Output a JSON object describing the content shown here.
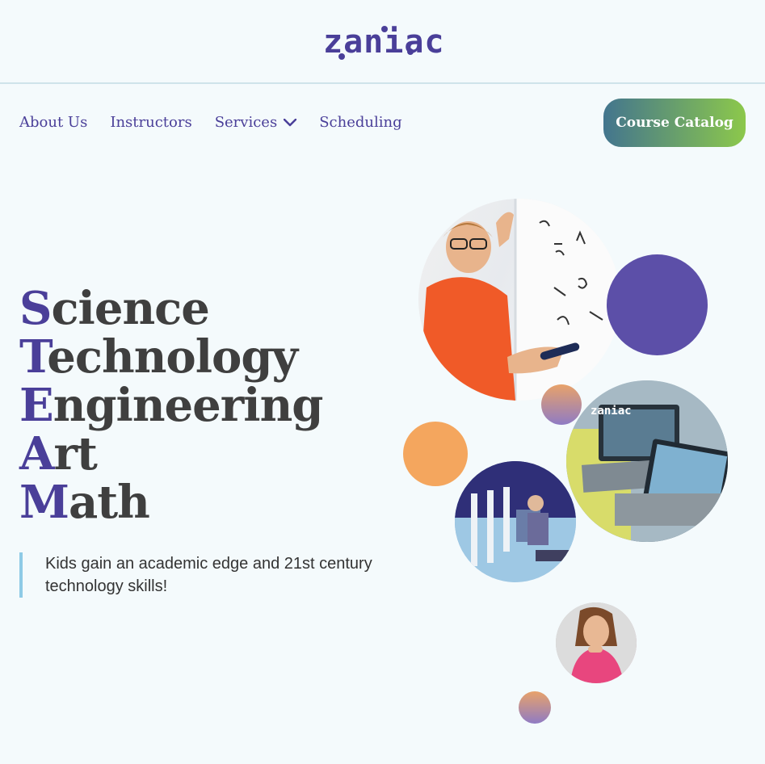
{
  "logo": {
    "text": "zaniac"
  },
  "nav": {
    "items": [
      {
        "label": "About Us"
      },
      {
        "label": "Instructors"
      },
      {
        "label": "Services"
      },
      {
        "label": "Scheduling"
      }
    ],
    "cta_label": "Course Catalog"
  },
  "hero": {
    "steam": [
      {
        "initial": "S",
        "rest": "cience"
      },
      {
        "initial": "T",
        "rest": "echnology"
      },
      {
        "initial": "E",
        "rest": "ngineering"
      },
      {
        "initial": "A",
        "rest": "rt"
      },
      {
        "initial": "M",
        "rest": "ath"
      }
    ],
    "tagline": "Kids gain an academic edge and 21st century technology skills!"
  },
  "colors": {
    "brand_purple": "#4a3f99",
    "accent_orange": "#f4a65e",
    "cta_gradient_start": "#43758e",
    "cta_gradient_end": "#8cc84b",
    "background": "#f4fafc"
  }
}
